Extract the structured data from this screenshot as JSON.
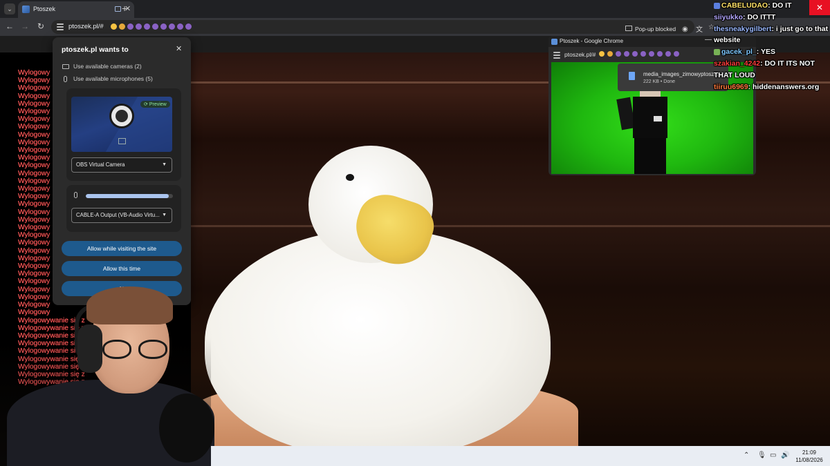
{
  "browser": {
    "tab_title": "Ptoszek",
    "url": "ptoszek.pl/#",
    "url_emojis": [
      "#f6c343",
      "#e6a93a",
      "#8a62c4",
      "#8a62c4",
      "#8a62c4",
      "#8a62c4",
      "#8a62c4",
      "#8a62c4",
      "#8a62c4",
      "#8a62c4"
    ],
    "popup_blocked_label": "Pop-up blocked"
  },
  "permission": {
    "title": "ptoszek.pl wants to",
    "camera_row": "Use available cameras (2)",
    "mic_row": "Use available microphones (5)",
    "preview_chip": "Preview",
    "camera_select": "OBS Virtual Camera",
    "mic_select": "CABLE-A Output (VB-Audio Virtu...",
    "mic_level": 0.95,
    "allow_visiting": "Allow while visiting the site",
    "allow_once": "Allow this time",
    "never_partial": "N"
  },
  "log": {
    "line": "Wylogowywanie się z P",
    "line_short": "Wylogowy"
  },
  "mini_window": {
    "title": "Ptoszek - Google Chrome",
    "url": "ptoszek.pl/#",
    "download_name": "media_images_zimowyptoszek.jpeg",
    "download_meta": "222 KB • Done"
  },
  "chat": [
    {
      "user": "CABELUDAO",
      "color": "#ffe066",
      "text": ": DO IT"
    },
    {
      "user": "siiyukko",
      "color": "#b3a6ff",
      "text": ": DO ITTT"
    },
    {
      "user": "thesneakygilbert",
      "color": "#9ab8ff",
      "text": ": i just go to that website"
    },
    {
      "user": "gacek_pl_",
      "color": "#7ec8ff",
      "text": ": YES"
    },
    {
      "user": "szakian_4242",
      "color": "#ff3b3b",
      "text": ": DO IT ITS NOT THAT LOUD"
    },
    {
      "user": "tiiruu6969",
      "color": "#ff7a3d",
      "text": ": hiddenanswers.org"
    }
  ],
  "taskbar": {
    "time": "21:09",
    "date": "11/08/2026"
  },
  "colors": {
    "chrome_dark": "#202124",
    "button_blue": "#1e5a8d",
    "log_red": "#ff6b6b",
    "green_screen": "#22c411"
  }
}
